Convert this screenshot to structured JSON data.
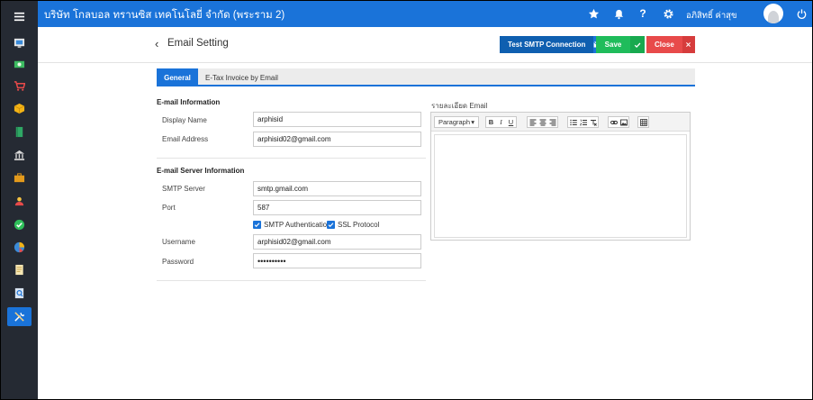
{
  "app": {
    "company": "บริษัท โกลบอล ทรานซิส เทคโนโลยี่ จำกัด (พระราม 2)",
    "user_name": "อภิสิทธิ์ ค่าสุข"
  },
  "sidebar": {
    "items": [
      "home-icon",
      "money-icon",
      "cart-icon",
      "box-icon",
      "book-icon",
      "bank-icon",
      "briefcase-icon",
      "people-icon",
      "check-circle-icon",
      "pie-chart-icon",
      "document-icon",
      "search-document-icon",
      "tools-icon"
    ],
    "active": "tools-icon"
  },
  "header": {
    "back_symbol": "‹",
    "title": "Email Setting",
    "test_smtp_label": "Test SMTP Connection",
    "save_label": "Save",
    "close_label": "Close"
  },
  "tabs": [
    {
      "label": "General",
      "active": true
    },
    {
      "label": "E-Tax Invoice by Email",
      "active": false
    }
  ],
  "email_info": {
    "section_title": "E-mail Information",
    "display_name_label": "Display Name",
    "display_name_value": "arphisid",
    "email_label": "Email Address",
    "email_value": "arphisid02@gmail.com"
  },
  "server_info": {
    "section_title": "E-mail Server Information",
    "smtp_label": "SMTP Server",
    "smtp_value": "smtp.gmail.com",
    "port_label": "Port",
    "port_value": "587",
    "smtp_auth_label": "SMTP Authentication",
    "smtp_auth_checked": true,
    "ssl_label": "SSL Protocol",
    "ssl_checked": true,
    "username_label": "Username",
    "username_value": "arphisid02@gmail.com",
    "password_label": "Password",
    "password_value": "••••••••••"
  },
  "editor": {
    "label": "รายละเอียด Email",
    "format_value": "Paragraph",
    "bold": "B",
    "italic": "I",
    "underline": "U"
  },
  "colors": {
    "primary": "#1a73d9",
    "sidebar": "#252a33",
    "save": "#1fbc5b",
    "close": "#e84a4a",
    "test": "#0f5fb0"
  }
}
